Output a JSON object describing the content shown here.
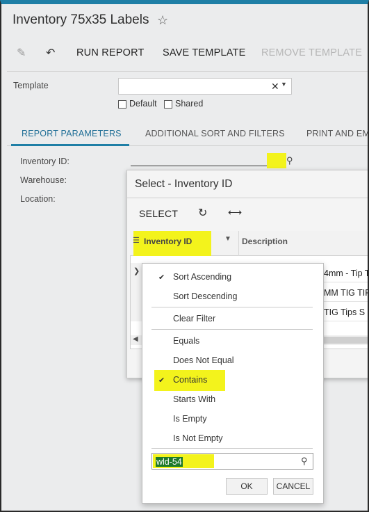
{
  "window": {
    "title": "Inventory 75x35 Labels"
  },
  "toolbar": {
    "run_report": "RUN REPORT",
    "save_template": "SAVE TEMPLATE",
    "remove_template": "REMOVE TEMPLATE"
  },
  "template_section": {
    "template_label": "Template",
    "template_value": "",
    "default_label": "Default",
    "shared_label": "Shared",
    "default_checked": false,
    "shared_checked": false
  },
  "tabs": [
    {
      "label": "REPORT PARAMETERS",
      "active": true
    },
    {
      "label": "ADDITIONAL SORT AND FILTERS",
      "active": false
    },
    {
      "label": "PRINT AND EM",
      "active": false
    }
  ],
  "params": {
    "inventory_id_label": "Inventory ID:",
    "warehouse_label": "Warehouse:",
    "location_label": "Location:",
    "inventory_id_value": ""
  },
  "lookup": {
    "title": "Select - Inventory ID",
    "select_label": "SELECT",
    "columns": [
      "Inventory ID",
      "Description"
    ],
    "rows": [
      {
        "description": "4mm - Tip T"
      },
      {
        "description": "MM TIG TIP"
      },
      {
        "description": "TIG Tips S"
      }
    ]
  },
  "column_menu": {
    "items": [
      {
        "label": "Sort Ascending",
        "checked": true
      },
      {
        "label": "Sort Descending",
        "checked": false
      },
      {
        "label": "Clear Filter",
        "checked": false
      },
      {
        "label": "Equals",
        "checked": false
      },
      {
        "label": "Does Not Equal",
        "checked": false
      },
      {
        "label": "Contains",
        "checked": true
      },
      {
        "label": "Starts With",
        "checked": false
      },
      {
        "label": "Is Empty",
        "checked": false
      },
      {
        "label": "Is Not Empty",
        "checked": false
      }
    ],
    "filter_value": "wld-54",
    "ok_label": "OK",
    "cancel_label": "CANCEL"
  },
  "colors": {
    "accent": "#1f7fa6",
    "highlight": "#f3f31c",
    "selection": "#1e7a2a"
  }
}
